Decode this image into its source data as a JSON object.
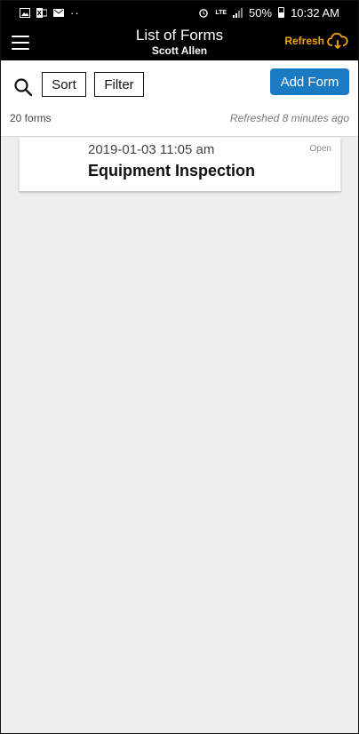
{
  "status_bar": {
    "battery": "50%",
    "time": "10:32 AM",
    "network": "LTE",
    "dots": "··"
  },
  "header": {
    "title": "List of Forms",
    "subtitle": "Scott Allen",
    "refresh_label": "Refresh"
  },
  "toolbar": {
    "sort_label": "Sort",
    "filter_label": "Filter",
    "add_label": "Add Form",
    "count_text": "20 forms",
    "refreshed_text": "Refreshed 8 minutes ago"
  },
  "forms": [
    {
      "datetime": "2019-01-03 11:05 am",
      "title": "Equipment Inspection",
      "status": "Open"
    }
  ],
  "colors": {
    "accent_blue": "#1b7ac4",
    "refresh_orange": "#f2a400",
    "header_bg": "#000000",
    "list_bg": "#eeeeee"
  },
  "icons": [
    "image-icon",
    "excel-icon",
    "email-icon",
    "alarm-icon",
    "signal-icon",
    "battery-icon",
    "menu-icon",
    "cloud-download-icon",
    "search-icon"
  ]
}
